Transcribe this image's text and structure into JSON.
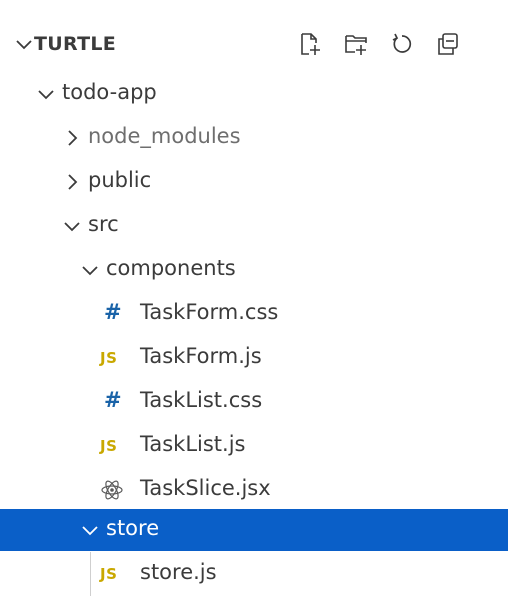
{
  "explorer": {
    "section_title": "TURTLE",
    "actions": {
      "new_file": "new-file-icon",
      "new_folder": "new-folder-icon",
      "refresh": "refresh-icon",
      "collapse": "collapse-all-icon"
    }
  },
  "tree": [
    {
      "label": "todo-app",
      "type": "folder",
      "expanded": true,
      "depth": 1
    },
    {
      "label": "node_modules",
      "type": "folder",
      "expanded": false,
      "depth": 2,
      "dim": true
    },
    {
      "label": "public",
      "type": "folder",
      "expanded": false,
      "depth": 2
    },
    {
      "label": "src",
      "type": "folder",
      "expanded": true,
      "depth": 2
    },
    {
      "label": "components",
      "type": "folder",
      "expanded": true,
      "depth": 3
    },
    {
      "label": "TaskForm.css",
      "type": "css",
      "icon_text": "#",
      "depth": 4
    },
    {
      "label": "TaskForm.js",
      "type": "js",
      "icon_text": "JS",
      "depth": 4
    },
    {
      "label": "TaskList.css",
      "type": "css",
      "icon_text": "#",
      "depth": 4
    },
    {
      "label": "TaskList.js",
      "type": "js",
      "icon_text": "JS",
      "depth": 4
    },
    {
      "label": "TaskSlice.jsx",
      "type": "react",
      "depth": 4
    },
    {
      "label": "store",
      "type": "folder",
      "expanded": true,
      "depth": 3,
      "selected": true
    },
    {
      "label": "store.js",
      "type": "js",
      "icon_text": "JS",
      "depth": 4
    }
  ],
  "colors": {
    "selection": "#0a5fc8",
    "css_icon": "#1a63a8",
    "js_icon": "#c9a800"
  }
}
